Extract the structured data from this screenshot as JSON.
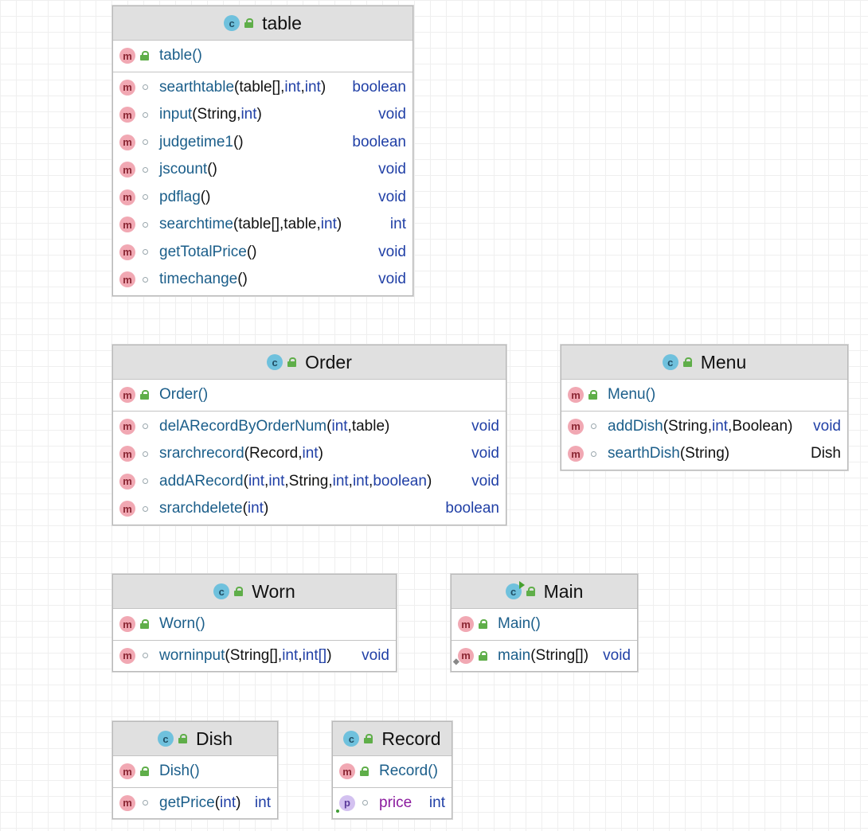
{
  "classes": {
    "table": {
      "name": "table",
      "ctor": "table()",
      "methods": [
        {
          "name": "searthtable",
          "sig": [
            "(",
            "table[]",
            ", ",
            "int",
            ", ",
            "int",
            ")"
          ],
          "ret": "boolean"
        },
        {
          "name": "input",
          "sig": [
            "(",
            "String",
            ", ",
            "int",
            ")"
          ],
          "ret": "void"
        },
        {
          "name": "judgetime1",
          "sig": [
            "()"
          ],
          "ret": "boolean"
        },
        {
          "name": "jscount",
          "sig": [
            "()"
          ],
          "ret": "void"
        },
        {
          "name": "pdflag",
          "sig": [
            "()"
          ],
          "ret": "void"
        },
        {
          "name": "searchtime",
          "sig": [
            "(",
            "table[]",
            ", ",
            "table",
            ", ",
            "int",
            ")"
          ],
          "ret": "int"
        },
        {
          "name": "getTotalPrice",
          "sig": [
            "()"
          ],
          "ret": "void"
        },
        {
          "name": "timechange",
          "sig": [
            "()"
          ],
          "ret": "void"
        }
      ]
    },
    "order": {
      "name": "Order",
      "ctor": "Order()",
      "methods": [
        {
          "name": "delARecordByOrderNum",
          "sig": [
            "(",
            "int",
            ", ",
            "table",
            ")"
          ],
          "ret": "void"
        },
        {
          "name": "srarchrecord",
          "sig": [
            "(",
            "Record",
            ", ",
            "int",
            ")"
          ],
          "ret": "void"
        },
        {
          "name": "addARecord",
          "sig": [
            "(",
            "int",
            ", ",
            "int",
            ", ",
            "String",
            ", ",
            "int",
            ", ",
            "int",
            ", ",
            "boolean",
            ")"
          ],
          "ret": "void"
        },
        {
          "name": "srarchdelete",
          "sig": [
            "(",
            "int",
            ")"
          ],
          "ret": "boolean"
        }
      ]
    },
    "menu": {
      "name": "Menu",
      "ctor": "Menu()",
      "methods": [
        {
          "name": "addDish",
          "sig": [
            "(",
            "String",
            ", ",
            "int",
            ", ",
            "Boolean",
            ")"
          ],
          "ret": "void"
        },
        {
          "name": "searthDish",
          "sig": [
            "(",
            "String",
            ")"
          ],
          "ret": "Dish"
        }
      ]
    },
    "worn": {
      "name": "Worn",
      "ctor": "Worn()",
      "methods": [
        {
          "name": "worninput",
          "sig": [
            "(",
            "String[]",
            ", ",
            "int",
            ", ",
            "int[]",
            ")"
          ],
          "ret": "void"
        }
      ]
    },
    "main": {
      "name": "Main",
      "ctor": "Main()",
      "methods": [
        {
          "name": "main",
          "sig": [
            "(",
            "String[]",
            ")"
          ],
          "ret": "void"
        }
      ]
    },
    "dish": {
      "name": "Dish",
      "ctor": "Dish()",
      "methods": [
        {
          "name": "getPrice",
          "sig": [
            "(",
            "int",
            ")"
          ],
          "ret": "int"
        }
      ]
    },
    "record": {
      "name": "Record",
      "ctor": "Record()",
      "fields": [
        {
          "name": "price",
          "type": "int"
        }
      ]
    }
  },
  "icons": {
    "class": "c",
    "method": "m",
    "property": "p"
  },
  "keywords": [
    "int",
    "boolean",
    "void",
    "int[]"
  ]
}
